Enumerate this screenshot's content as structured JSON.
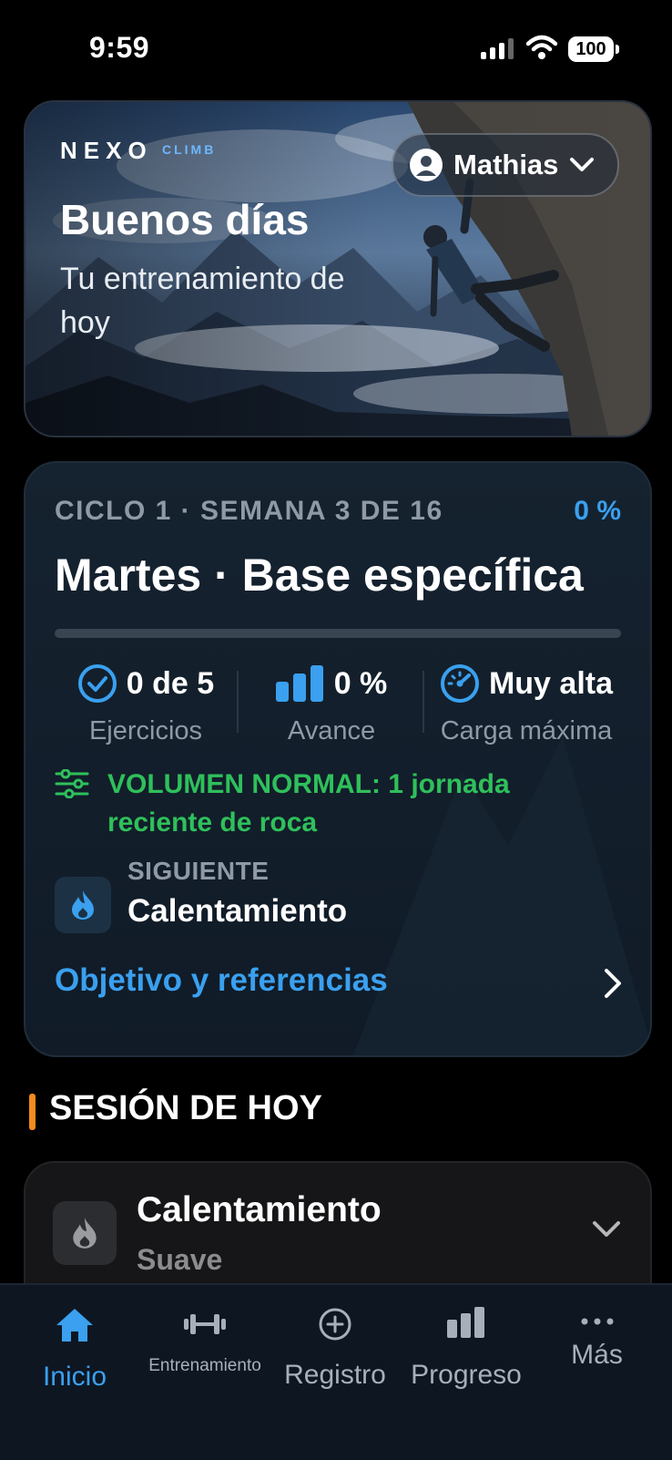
{
  "status_bar": {
    "time": "9:59",
    "battery": "100"
  },
  "hero": {
    "brand": "NEXO",
    "brand_sub": "CLIMB",
    "user_name": "Mathias",
    "greeting": "Buenos días",
    "subtitle": "Tu entrenamiento de hoy"
  },
  "plan": {
    "cycle": "CICLO 1 · SEMANA 3 DE 16",
    "percent": "0 %",
    "progress_fraction": 0,
    "title": "Martes · Base específica",
    "stats": [
      {
        "value": "0 de 5",
        "label": "Ejercicios",
        "icon": "check-circle-icon"
      },
      {
        "value": "0 %",
        "label": "Avance",
        "icon": "bar-chart-icon"
      },
      {
        "value": "Muy alta",
        "label": "Carga máxima",
        "icon": "speedometer-icon"
      }
    ],
    "volume": "VOLUMEN NORMAL: 1 jornada reciente de roca",
    "next_label": "SIGUIENTE",
    "next_value": "Calentamiento",
    "objective_link": "Objetivo y referencias"
  },
  "section": {
    "title": "SESIÓN DE HOY",
    "accent": "#f38a1e"
  },
  "session": {
    "title": "Calentamiento",
    "subtitle": "Suave"
  },
  "tabs": [
    {
      "label": "Inicio",
      "icon": "home-icon"
    },
    {
      "label": "Entrenamiento",
      "icon": "dumbbell-icon"
    },
    {
      "label": "Registro",
      "icon": "plus-circle-icon"
    },
    {
      "label": "Progreso",
      "icon": "bar-chart-icon"
    },
    {
      "label": "Más",
      "icon": "more-icon"
    }
  ],
  "colors": {
    "accent_blue": "#3aa0ef",
    "success_green": "#2fc05b",
    "background": "#000000"
  }
}
